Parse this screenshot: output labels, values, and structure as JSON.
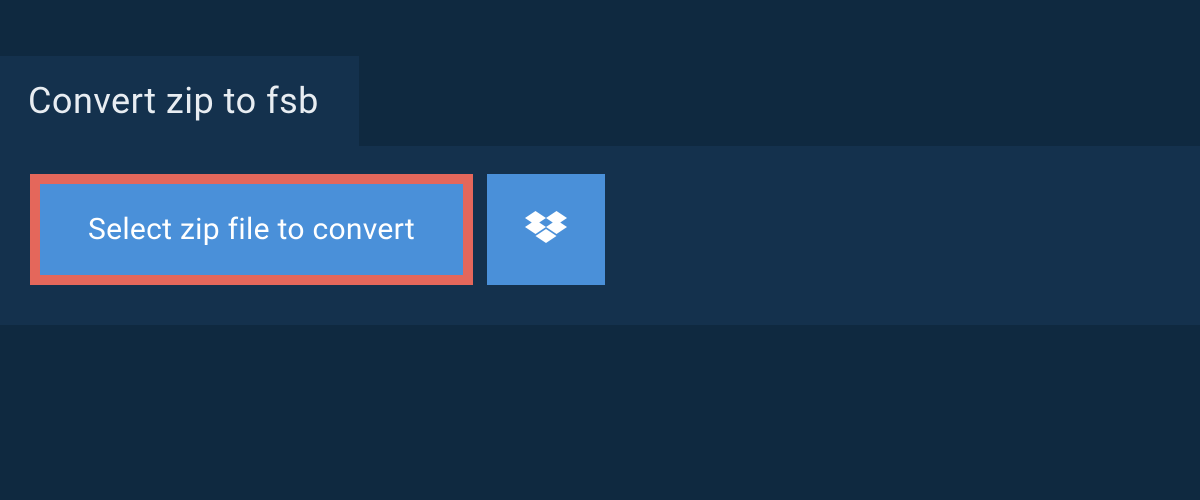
{
  "tab": {
    "title": "Convert zip to fsb"
  },
  "actions": {
    "select_file_label": "Select zip file to convert"
  }
}
